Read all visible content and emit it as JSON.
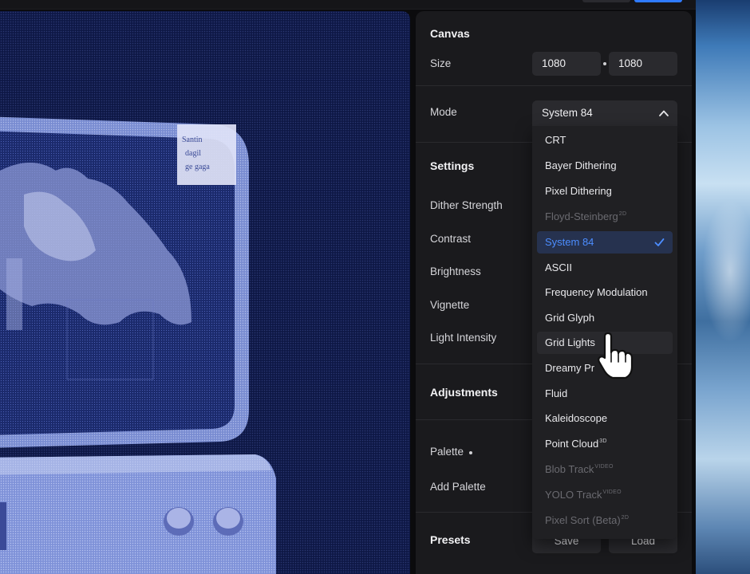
{
  "canvas": {
    "title": "Canvas",
    "size_label": "Size",
    "width": "1080",
    "height": "1080",
    "mode_label": "Mode",
    "mode_value": "System 84"
  },
  "settings": {
    "title": "Settings",
    "rows": [
      "Dither Strength",
      "Contrast",
      "Brightness",
      "Vignette",
      "Light Intensity"
    ]
  },
  "adjustments": {
    "title": "Adjustments",
    "palette_label": "Palette",
    "add_palette_label": "Add Palette"
  },
  "presets": {
    "title": "Presets",
    "save_label": "Save",
    "load_label": "Load"
  },
  "mode_options": [
    {
      "label": "CRT",
      "badge": "",
      "state": "enabled"
    },
    {
      "label": "Bayer Dithering",
      "badge": "",
      "state": "enabled"
    },
    {
      "label": "Pixel Dithering",
      "badge": "",
      "state": "enabled"
    },
    {
      "label": "Floyd-Steinberg",
      "badge": "2D",
      "state": "disabled"
    },
    {
      "label": "System 84",
      "badge": "",
      "state": "selected"
    },
    {
      "label": "ASCII",
      "badge": "",
      "state": "enabled"
    },
    {
      "label": "Frequency Modulation",
      "badge": "",
      "state": "enabled"
    },
    {
      "label": "Grid Glyph",
      "badge": "",
      "state": "enabled"
    },
    {
      "label": "Grid Lights",
      "badge": "",
      "state": "hover"
    },
    {
      "label": "Dreamy Pr",
      "badge": "",
      "state": "enabled"
    },
    {
      "label": "Fluid",
      "badge": "",
      "state": "enabled"
    },
    {
      "label": "Kaleidoscope",
      "badge": "",
      "state": "enabled"
    },
    {
      "label": "Point Cloud",
      "badge": "3D",
      "state": "enabled"
    },
    {
      "label": "Blob Track",
      "badge": "VIDEO",
      "state": "disabled"
    },
    {
      "label": "YOLO Track",
      "badge": "VIDEO",
      "state": "disabled"
    },
    {
      "label": "Pixel Sort (Beta)",
      "badge": "2D",
      "state": "disabled"
    }
  ],
  "preview": {
    "note_text": "Santin dagil ge gaga"
  },
  "colors": {
    "accent": "#4c8dff",
    "panel_bg": "#1a1a1d",
    "preview_bg": "#0e1846",
    "selected_bg": "#26324f"
  },
  "icons": {
    "chevron": "chevron-up-icon",
    "check": "checkmark-icon",
    "cursor": "hand-pointer-cursor-icon"
  }
}
